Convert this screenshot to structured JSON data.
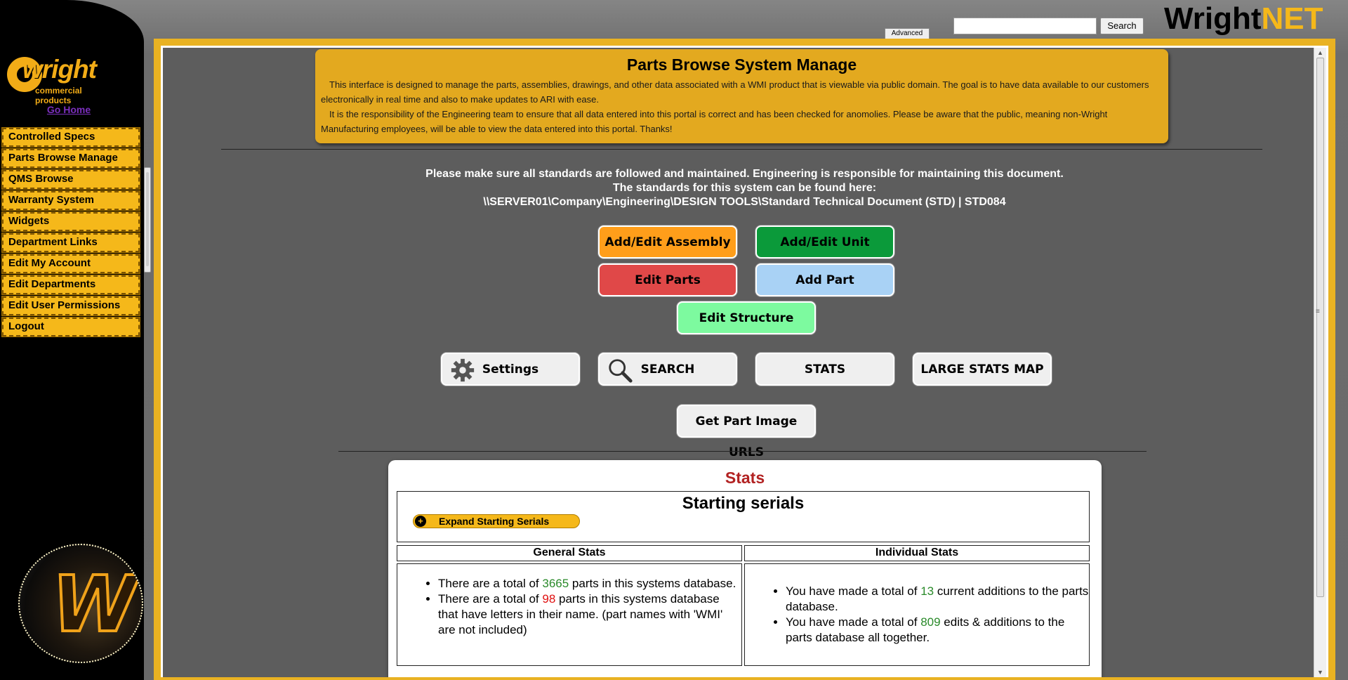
{
  "sidebar": {
    "logo": {
      "word": "wright",
      "sub": "commercial products"
    },
    "go_home": "Go Home",
    "items": [
      {
        "label": "Controlled Specs"
      },
      {
        "label": "Parts Browse Manage"
      },
      {
        "label": "QMS Browse"
      },
      {
        "label": "Warranty System"
      },
      {
        "label": "Widgets"
      },
      {
        "label": "Department Links"
      },
      {
        "label": "Edit My Account"
      },
      {
        "label": "Edit Departments"
      },
      {
        "label": "Edit User Permissions"
      },
      {
        "label": "Logout"
      }
    ]
  },
  "header": {
    "advanced_label": "Advanced",
    "search_value": "",
    "search_label": "Search",
    "brand_part1": "Wright",
    "brand_part2": "NET",
    "brand_color": "#f5b81a"
  },
  "info": {
    "title": "Parts Browse System Manage",
    "para1": "This interface is designed to manage the parts, assemblies, drawings, and other data associated with a WMI product that is viewable via public domain. The goal is to have data available to our customers electronically in real time and also to make updates to ARI with ease.",
    "para2": "It is the responsibility of the Engineering team to ensure that all data entered into this portal is correct and has been checked for anomolies. Please be aware that the public, meaning non-Wright Manufacturing employees, will be able to view the data entered into this portal. Thanks!"
  },
  "notice": {
    "line1": "Please make sure all standards are followed and maintained. Engineering is responsible for maintaining this document.",
    "line2": "The standards for this system can be found here:",
    "line3": "\\\\SERVER01\\Company\\Engineering\\DESIGN TOOLS\\Standard Technical Document (STD) | STD084"
  },
  "buttons": {
    "add_edit_assembly": {
      "label": "Add/Edit Assembly",
      "color": "#ff9e1a"
    },
    "add_edit_unit": {
      "label": "Add/Edit Unit",
      "color": "#0b9a3a"
    },
    "edit_parts": {
      "label": "Edit Parts",
      "color": "#e04848"
    },
    "add_part": {
      "label": "Add Part",
      "color": "#a9d2f5"
    },
    "edit_structure": {
      "label": "Edit Structure",
      "color": "#7dfa9f"
    },
    "settings": {
      "label": "Settings",
      "icon": "gear-icon"
    },
    "search": {
      "label": "SEARCH",
      "icon": "magnifier-icon"
    },
    "stats": {
      "label": "STATS"
    },
    "large_stats_map": {
      "label": "LARGE STATS MAP"
    },
    "get_part_image_urls": {
      "label": "Get Part Image URLS"
    }
  },
  "stats": {
    "title": "Stats",
    "serials_title": "Starting serials",
    "expand_label": "Expand Starting Serials",
    "general_header": "General Stats",
    "individual_header": "Individual Stats",
    "general": [
      {
        "pre": "There are a total of ",
        "num": "3665",
        "post": " parts in this systems database."
      },
      {
        "pre": "There are a total of ",
        "num": "98",
        "post": " parts in this systems database that have letters in their name. (part names with 'WMI' are not included)"
      }
    ],
    "individual": [
      {
        "pre": "You have made a total of ",
        "num": "13",
        "post": " current additions to the parts database."
      },
      {
        "pre": "You have made a total of ",
        "num": "809",
        "post": " edits & additions to the parts database all together."
      }
    ]
  }
}
